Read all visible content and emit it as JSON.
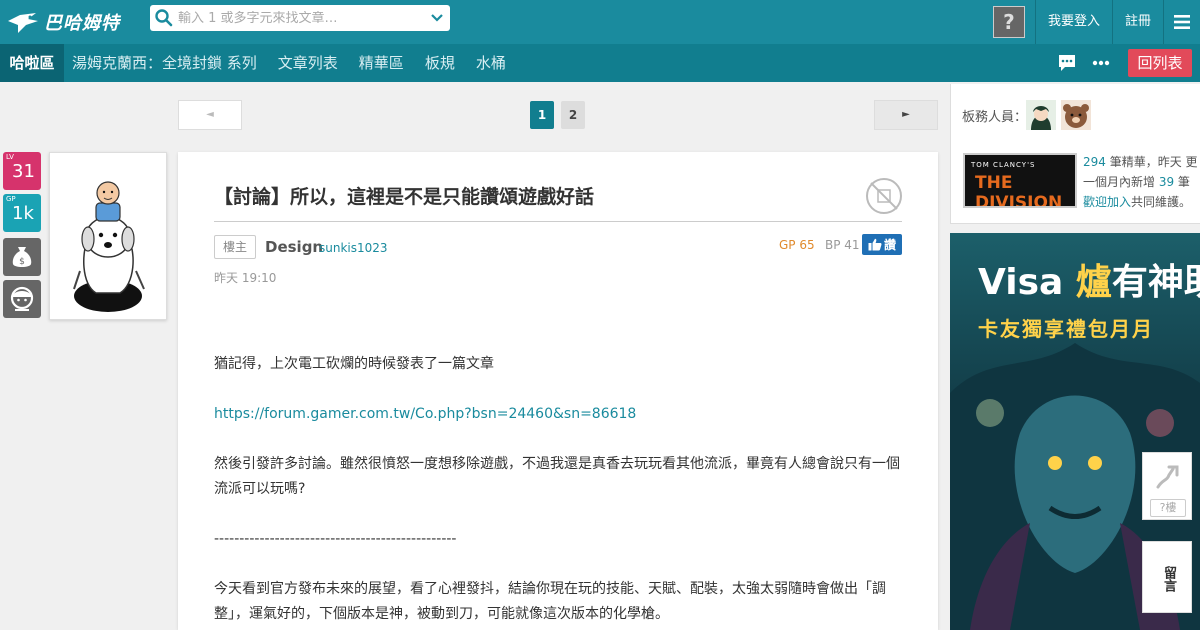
{
  "header": {
    "logo_text": "巴哈姆特",
    "search_placeholder": "輸入 1 或多字元來找文章…",
    "login_label": "我要登入",
    "register_label": "註冊",
    "guest_avatar_glyph": "?"
  },
  "nav": {
    "home_label": "哈啦區",
    "items": [
      "湯姆克蘭西：全境封鎖 系列",
      "文章列表",
      "精華區",
      "板規",
      "水桶"
    ],
    "back_label": "回列表"
  },
  "pagination": {
    "prev": "◄",
    "next": "►",
    "pages": [
      "1",
      "2"
    ],
    "current": "1"
  },
  "author": {
    "lv_label": "LV",
    "lv_value": "31",
    "gp_label": "GP",
    "gp_value": "1k"
  },
  "post": {
    "title": "【討論】所以，這裡是不是只能讚頌遊戲好話",
    "floor_tag": "樓主",
    "author_name": "Design",
    "author_id": "sunkis1023",
    "time": "昨天 19:10",
    "gp": "GP 65",
    "bp": "BP 41",
    "like_label": "讚",
    "paragraphs": [
      "猶記得，上次電工砍爛的時候發表了一篇文章",
      "https://forum.gamer.com.tw/Co.php?bsn=24460&sn=86618",
      "然後引發許多討論。雖然很憤怒一度想移除遊戲，不過我還是真香去玩玩看其他流派，畢竟有人總會說只有一個流派可以玩嗎?",
      "------------------------------------------------",
      "今天看到官方發布未來的展望，看了心裡發抖，結論你現在玩的技能、天賦、配裝，太強太弱隨時會做出「調整」，運氣好的，下個版本是神，被動到刀，可能就像這次版本的化學槍。"
    ]
  },
  "sidebar": {
    "mods_label": "板務人員：",
    "board_image_small": "TOM CLANCY'S",
    "board_image_big": "THE DIVISION",
    "info_count": "294",
    "info_line1_rest": " 筆精華，昨天 更",
    "info_line2_pre": "一個月內新增 ",
    "info_new": "39",
    "info_line2_post": " 筆",
    "info_join": "歡迎加入",
    "info_line3_post": "共同維護。"
  },
  "ad": {
    "line1_a": "Visa ",
    "line1_b": "爐",
    "line1_c": "有神助",
    "line2": "卡友獨享禮包月月"
  },
  "floating": {
    "floor_jump": "?樓",
    "vertical_label": "留言"
  },
  "colors": {
    "topbar": "#1a8b9e",
    "navbar": "#117e8f",
    "accent_red": "#e24a5a",
    "link": "#1a8b9e",
    "lv_badge": "#d6336c",
    "gp_badge": "#1aa3b4"
  }
}
